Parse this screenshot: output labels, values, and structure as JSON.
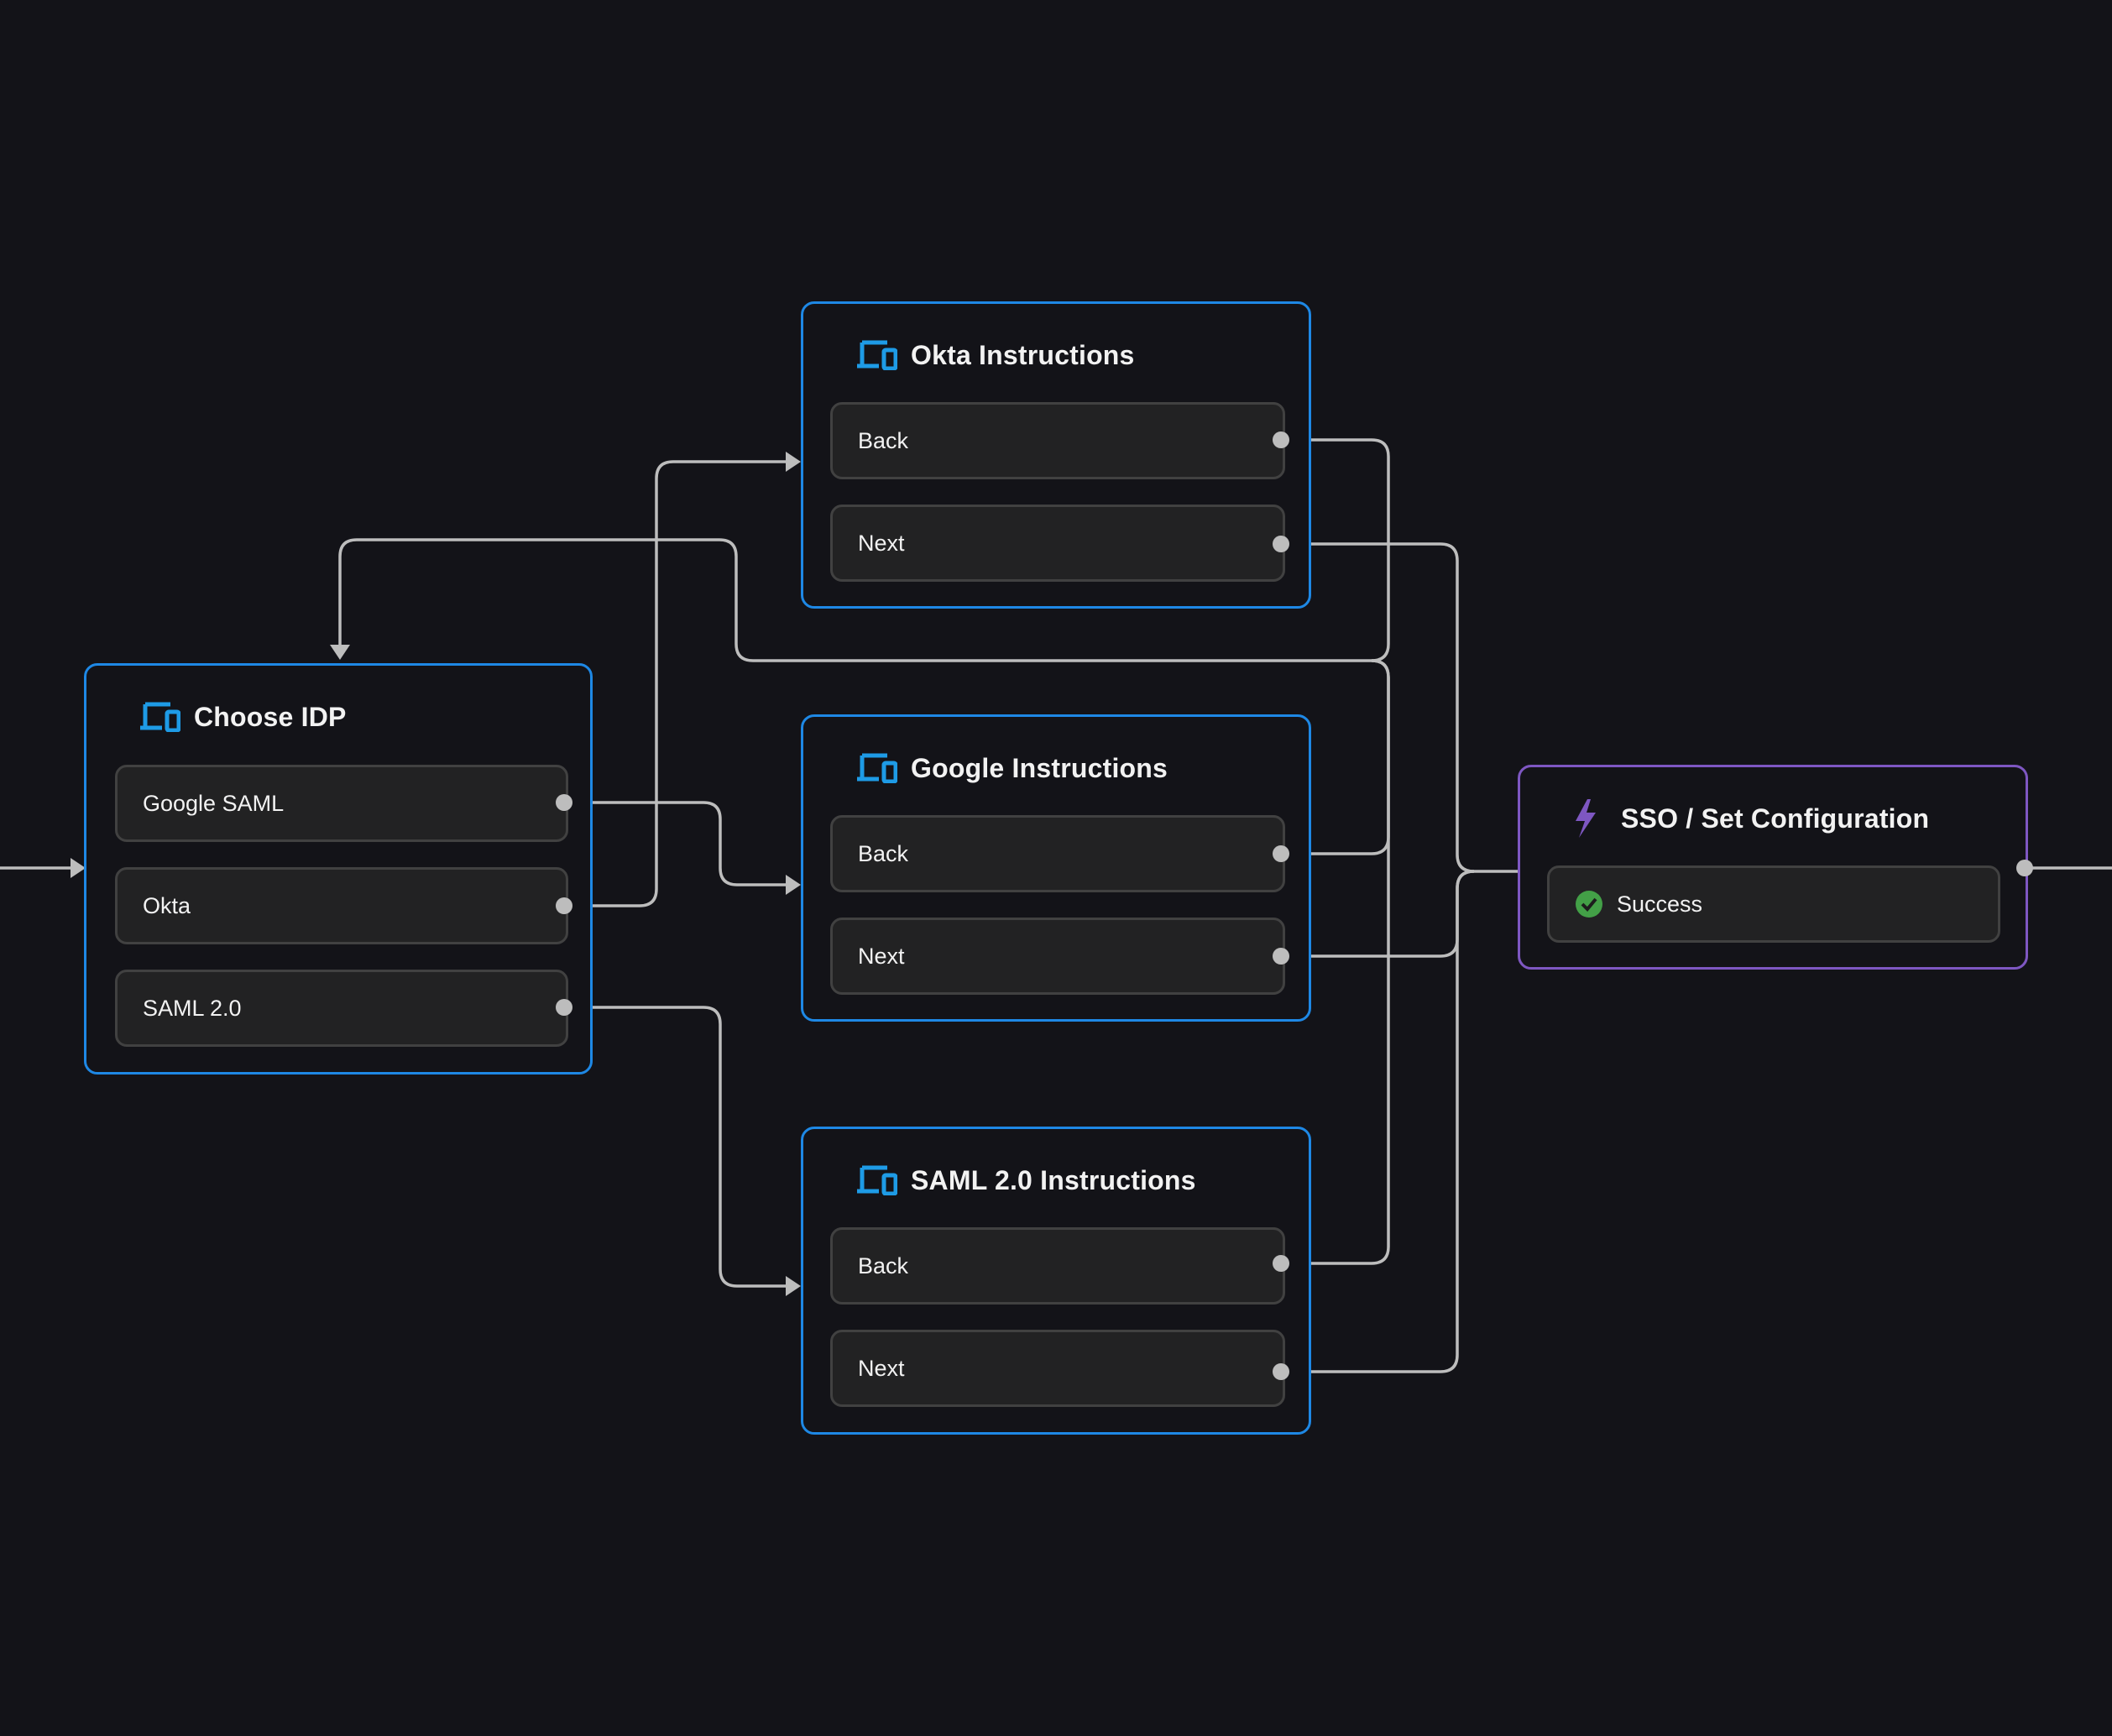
{
  "canvas": {
    "background": "#131318",
    "edge_color": "#bdbdbd"
  },
  "colors": {
    "screen_node_border": "#1e88e5",
    "action_node_border": "#7e57c2",
    "port_bg": "#222223",
    "port_border": "#414141",
    "success": "#43a047"
  },
  "nodes": {
    "choose_idp": {
      "title": "Choose IDP",
      "icon": "devices-icon",
      "type": "screen",
      "options": [
        {
          "label": "Google SAML"
        },
        {
          "label": "Okta"
        },
        {
          "label": "SAML 2.0"
        }
      ]
    },
    "okta": {
      "title": "Okta Instructions",
      "icon": "devices-icon",
      "type": "screen",
      "options": [
        {
          "label": "Back"
        },
        {
          "label": "Next"
        }
      ]
    },
    "google": {
      "title": "Google Instructions",
      "icon": "devices-icon",
      "type": "screen",
      "options": [
        {
          "label": "Back"
        },
        {
          "label": "Next"
        }
      ]
    },
    "saml": {
      "title": "SAML 2.0 Instructions",
      "icon": "devices-icon",
      "type": "screen",
      "options": [
        {
          "label": "Back"
        },
        {
          "label": "Next"
        }
      ]
    },
    "sso": {
      "title": "SSO / Set Configuration",
      "icon": "lightning-icon",
      "type": "action",
      "options": [
        {
          "label": "Success",
          "icon": "check-circle-icon"
        }
      ]
    }
  },
  "edges": [
    {
      "from": "entry",
      "to": "choose_idp"
    },
    {
      "from": "choose_idp.Google SAML",
      "to": "google"
    },
    {
      "from": "choose_idp.Okta",
      "to": "okta"
    },
    {
      "from": "choose_idp.SAML 2.0",
      "to": "saml"
    },
    {
      "from": "okta.Back",
      "to": "choose_idp"
    },
    {
      "from": "google.Back",
      "to": "choose_idp"
    },
    {
      "from": "saml.Back",
      "to": "choose_idp"
    },
    {
      "from": "okta.Next",
      "to": "sso"
    },
    {
      "from": "google.Next",
      "to": "sso"
    },
    {
      "from": "saml.Next",
      "to": "sso"
    },
    {
      "from": "sso",
      "to": "exit"
    }
  ]
}
